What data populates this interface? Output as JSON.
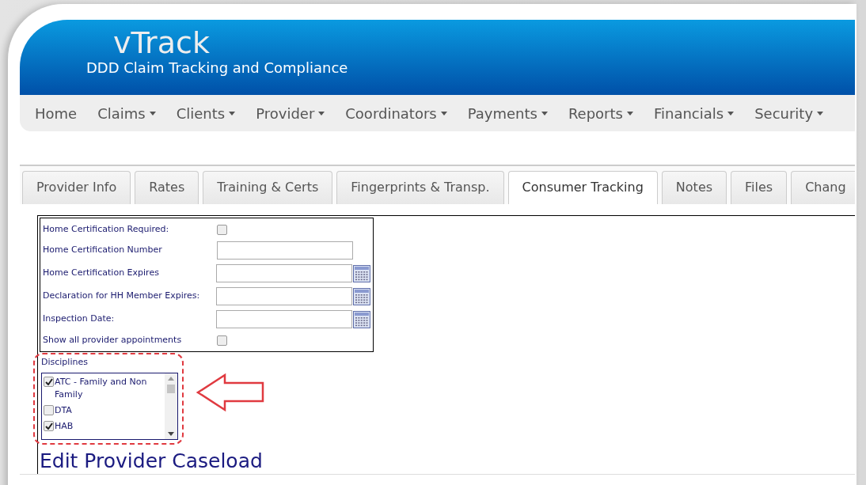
{
  "header": {
    "logo": "vTrack",
    "subtitle": "DDD Claim Tracking and Compliance"
  },
  "nav": [
    {
      "label": "Home",
      "dropdown": false
    },
    {
      "label": "Claims",
      "dropdown": true
    },
    {
      "label": "Clients",
      "dropdown": true
    },
    {
      "label": "Provider",
      "dropdown": true
    },
    {
      "label": "Coordinators",
      "dropdown": true
    },
    {
      "label": "Payments",
      "dropdown": true
    },
    {
      "label": "Reports",
      "dropdown": true
    },
    {
      "label": "Financials",
      "dropdown": true
    },
    {
      "label": "Security",
      "dropdown": true
    }
  ],
  "tabs": [
    {
      "label": "Provider Info",
      "selected": false
    },
    {
      "label": "Rates",
      "selected": false
    },
    {
      "label": "Training & Certs",
      "selected": false
    },
    {
      "label": "Fingerprints & Transp.",
      "selected": false
    },
    {
      "label": "Consumer Tracking",
      "selected": true
    },
    {
      "label": "Notes",
      "selected": false
    },
    {
      "label": "Files",
      "selected": false
    },
    {
      "label": "Chang",
      "selected": false
    }
  ],
  "form": {
    "fields": [
      {
        "kind": "checkbox",
        "label": "Home Certification Required:",
        "checked": false
      },
      {
        "kind": "text",
        "label": "Home Certification Number"
      },
      {
        "kind": "date",
        "label": "Home Certification Expires"
      },
      {
        "kind": "date",
        "label": "Declaration for HH Member Expires:"
      },
      {
        "kind": "date",
        "label": "Inspection Date:"
      },
      {
        "kind": "checkbox",
        "label": "Show all provider appointments",
        "checked": false
      }
    ]
  },
  "disciplines": {
    "label": "Disciplines",
    "items": [
      {
        "label": "ATC - Family and Non Family",
        "checked": true
      },
      {
        "label": "DTA",
        "checked": false
      },
      {
        "label": "HAB",
        "checked": true
      }
    ]
  },
  "heading": "Edit Provider Caseload"
}
